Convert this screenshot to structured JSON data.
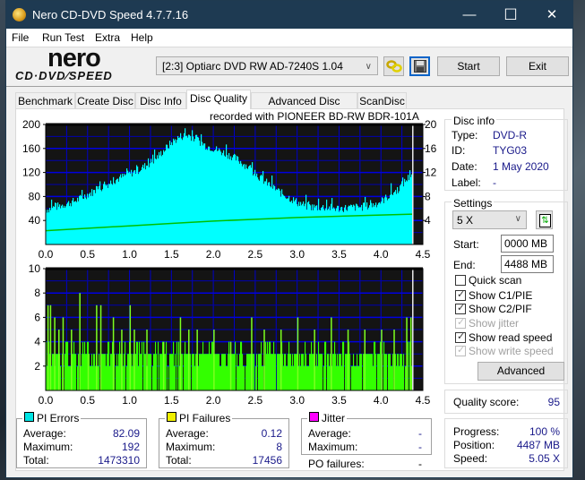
{
  "window": {
    "title": "Nero CD-DVD Speed 4.7.7.16",
    "minimize": "—",
    "maximize": "☐",
    "close": "✕"
  },
  "menu": [
    "File",
    "Run Test",
    "Extra",
    "Help"
  ],
  "logo": {
    "top": "nero",
    "bottom": "CD·DVD∕SPEED"
  },
  "toolbar": {
    "drive": "[2:3]  Optiarc DVD RW AD-7240S 1.04",
    "start": "Start",
    "exit": "Exit"
  },
  "tabs": [
    "Benchmark",
    "Create Disc",
    "Disc Info",
    "Disc Quality",
    "Advanced Disc Quality",
    "ScanDisc"
  ],
  "active_tab": "Disc Quality",
  "recorded_with": "recorded with PIONEER  BD-RW   BDR-101A",
  "disc_info": {
    "title": "Disc info",
    "type_label": "Type:",
    "type": "DVD-R",
    "id_label": "ID:",
    "id": "TYG03",
    "date_label": "Date:",
    "date": "1 May 2020",
    "label_label": "Label:",
    "label": "-"
  },
  "settings": {
    "title": "Settings",
    "speed": "5 X",
    "start_label": "Start:",
    "start": "0000 MB",
    "end_label": "End:",
    "end": "4488 MB",
    "quick_scan": "Quick scan",
    "show_c1": "Show C1/PIE",
    "show_c2": "Show C2/PIF",
    "show_jitter": "Show jitter",
    "show_read": "Show read speed",
    "show_write": "Show write speed",
    "advanced": "Advanced",
    "checks": {
      "quick_scan": false,
      "show_c1": true,
      "show_c2": true,
      "show_jitter": true,
      "show_read": true,
      "show_write": true
    }
  },
  "quality": {
    "label": "Quality score:",
    "value": "95"
  },
  "progress": {
    "progress_label": "Progress:",
    "progress": "100 %",
    "position_label": "Position:",
    "position": "4487 MB",
    "speed_label": "Speed:",
    "speed": "5.05 X"
  },
  "pi_errors": {
    "title": "PI Errors",
    "color": "#00e5e5",
    "avg_label": "Average:",
    "avg": "82.09",
    "max_label": "Maximum:",
    "max": "192",
    "total_label": "Total:",
    "total": "1473310"
  },
  "pi_failures": {
    "title": "PI Failures",
    "color": "#f0f000",
    "avg_label": "Average:",
    "avg": "0.12",
    "max_label": "Maximum:",
    "max": "8",
    "total_label": "Total:",
    "total": "17456"
  },
  "jitter": {
    "title": "Jitter",
    "color": "#ff00ff",
    "avg_label": "Average:",
    "avg": "-",
    "max_label": "Maximum:",
    "max": "-"
  },
  "po_failures": {
    "label": "PO failures:",
    "value": "-"
  },
  "chart_data": [
    {
      "type": "area",
      "title": "PI Errors",
      "xlim": [
        0,
        4.5
      ],
      "ylim": [
        0,
        200
      ],
      "y2lim": [
        0,
        20
      ],
      "xticks": [
        "0.0",
        "0.5",
        "1.0",
        "1.5",
        "2.0",
        "2.5",
        "3.0",
        "3.5",
        "4.0",
        "4.5"
      ],
      "yticks": [
        "40",
        "80",
        "120",
        "160",
        "200"
      ],
      "y2ticks": [
        "4",
        "8",
        "12",
        "16",
        "20"
      ],
      "grid": true,
      "end_x": 4.38,
      "series": [
        {
          "name": "PI Errors",
          "color": "#00ffff",
          "x": [
            0.0,
            0.1,
            0.2,
            0.3,
            0.4,
            0.5,
            0.6,
            0.7,
            0.8,
            0.9,
            1.0,
            1.1,
            1.2,
            1.3,
            1.4,
            1.5,
            1.6,
            1.7,
            1.8,
            1.9,
            2.0,
            2.1,
            2.2,
            2.3,
            2.4,
            2.5,
            2.6,
            2.7,
            2.8,
            2.9,
            3.0,
            3.1,
            3.2,
            3.3,
            3.4,
            3.5,
            3.6,
            3.7,
            3.8,
            3.9,
            4.0,
            4.1,
            4.2,
            4.3,
            4.38
          ],
          "values": [
            58,
            62,
            66,
            70,
            76,
            84,
            90,
            98,
            106,
            112,
            118,
            124,
            132,
            142,
            156,
            170,
            180,
            182,
            175,
            165,
            160,
            154,
            148,
            140,
            130,
            118,
            106,
            96,
            86,
            78,
            70,
            64,
            62,
            62,
            61,
            60,
            61,
            62,
            63,
            66,
            72,
            82,
            92,
            108,
            120
          ]
        },
        {
          "name": "Read Speed (X)",
          "color": "#00c000",
          "axis": "right",
          "x": [
            0.0,
            0.5,
            1.0,
            1.5,
            2.0,
            2.5,
            3.0,
            3.5,
            4.0,
            4.38
          ],
          "values": [
            2.3,
            2.7,
            3.1,
            3.5,
            3.9,
            4.2,
            4.5,
            4.7,
            4.9,
            5.05
          ]
        }
      ]
    },
    {
      "type": "bar",
      "title": "PI Failures",
      "xlim": [
        0,
        4.5
      ],
      "ylim": [
        0,
        10
      ],
      "xticks": [
        "0.0",
        "0.5",
        "1.0",
        "1.5",
        "2.0",
        "2.5",
        "3.0",
        "3.5",
        "4.0",
        "4.5"
      ],
      "yticks": [
        "2",
        "4",
        "6",
        "8",
        "10"
      ],
      "grid": true,
      "end_x": 4.38,
      "series": [
        {
          "name": "PI Failures",
          "color": "#33ff00",
          "x": [
            0.02,
            0.05,
            0.1,
            0.15,
            0.2,
            0.3,
            0.4,
            0.5,
            0.6,
            0.65,
            0.8,
            0.9,
            1.0,
            1.05,
            1.2,
            1.4,
            1.6,
            1.7,
            1.8,
            2.0,
            2.2,
            2.45,
            2.6,
            2.8,
            3.0,
            3.2,
            3.4,
            3.6,
            3.8,
            4.0,
            4.15,
            4.3,
            4.35
          ],
          "values": [
            7,
            7,
            6,
            5,
            6,
            5,
            8,
            3,
            7,
            7,
            6,
            5,
            7,
            5,
            5,
            4,
            6,
            5,
            5,
            5,
            4,
            6,
            5,
            5,
            6,
            5,
            6,
            5,
            5,
            5,
            5,
            6,
            6
          ]
        }
      ]
    }
  ]
}
